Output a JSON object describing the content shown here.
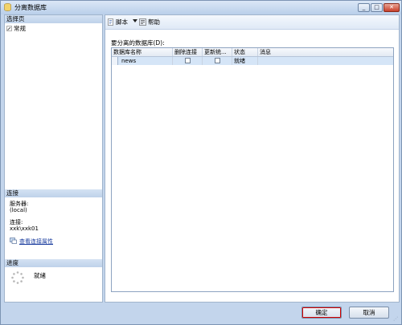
{
  "window": {
    "title": "分离数据库",
    "controls": {
      "minimize": "_",
      "maximize": "□",
      "close": "✕"
    }
  },
  "left_panel": {
    "pages_header": "选择页",
    "pages": [
      {
        "label": "常规",
        "icon": "wrench-page-icon"
      }
    ],
    "connection_header": "连接",
    "server_label": "服务器:",
    "server_value": "(local)",
    "connection_label": "连接:",
    "connection_value": "xxk\\xxk01",
    "view_link": "查看连接属性",
    "progress_header": "进度",
    "progress_status": "就绪"
  },
  "toolbar": {
    "script_label": "脚本",
    "help_label": "帮助"
  },
  "grid": {
    "label": "要分离的数据库(D):",
    "columns": [
      "数据库名称",
      "删除连接",
      "更新统...",
      "状态",
      "消息"
    ],
    "rows": [
      {
        "name": "news",
        "drop_connections": false,
        "update_statistics": false,
        "status": "就绪",
        "message": ""
      }
    ]
  },
  "buttons": {
    "ok": "确定",
    "cancel": "取消"
  },
  "colors": {
    "frame": "#c3d5ec",
    "selected_row": "#d5e5f7",
    "link": "#1a3c9e",
    "focus_outline": "#d10000"
  }
}
